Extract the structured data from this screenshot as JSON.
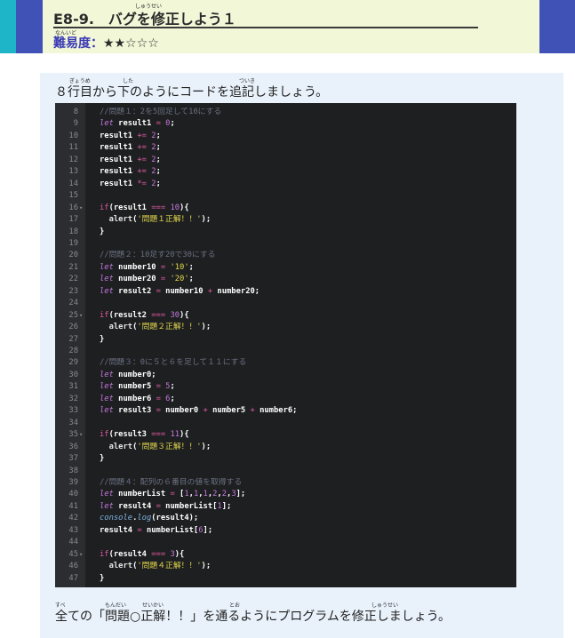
{
  "header": {
    "title": "E8-9.　バグを修正しよう１",
    "ruby_title": "しゅうせい",
    "difficulty_label": "難易度：",
    "ruby_difficulty": "なんいど",
    "difficulty_stars": "★★☆☆☆"
  },
  "intro": {
    "text": "８行目から下のようにコードを追記しましょう。",
    "ruby_1": "ぎょうめ",
    "ruby_2": "した",
    "ruby_3": "ついき"
  },
  "outro": {
    "text": "全ての「問題○正解！！」を通るようにプログラムを修正しましょう。",
    "ruby_1": "すべ",
    "ruby_2": "もんだい",
    "ruby_3": "せいかい",
    "ruby_4": "とお",
    "ruby_5": "しゅうせい"
  },
  "code": {
    "lines": [
      {
        "n": "8",
        "fold": "",
        "parts": [
          [
            "c-com",
            "//問題１：2を5回足して10にする"
          ]
        ]
      },
      {
        "n": "9",
        "fold": "",
        "parts": [
          [
            "c-kw",
            "let"
          ],
          [
            "c-plain",
            " result1 "
          ],
          [
            "c-op",
            "="
          ],
          [
            "c-plain",
            " "
          ],
          [
            "c-num",
            "0"
          ],
          [
            "c-plain",
            ";"
          ]
        ]
      },
      {
        "n": "10",
        "fold": "",
        "parts": [
          [
            "c-plain",
            "result1 "
          ],
          [
            "c-op",
            "+="
          ],
          [
            "c-plain",
            " "
          ],
          [
            "c-num",
            "2"
          ],
          [
            "c-plain",
            ";"
          ]
        ]
      },
      {
        "n": "11",
        "fold": "",
        "parts": [
          [
            "c-plain",
            "result1 "
          ],
          [
            "c-op",
            "+="
          ],
          [
            "c-plain",
            " "
          ],
          [
            "c-num",
            "2"
          ],
          [
            "c-plain",
            ";"
          ]
        ]
      },
      {
        "n": "12",
        "fold": "",
        "parts": [
          [
            "c-plain",
            "result1 "
          ],
          [
            "c-op",
            "+="
          ],
          [
            "c-plain",
            " "
          ],
          [
            "c-num",
            "2"
          ],
          [
            "c-plain",
            ";"
          ]
        ]
      },
      {
        "n": "13",
        "fold": "",
        "parts": [
          [
            "c-plain",
            "result1 "
          ],
          [
            "c-op",
            "+="
          ],
          [
            "c-plain",
            " "
          ],
          [
            "c-num",
            "2"
          ],
          [
            "c-plain",
            ";"
          ]
        ]
      },
      {
        "n": "14",
        "fold": "",
        "parts": [
          [
            "c-plain",
            "result1 "
          ],
          [
            "c-op",
            "*="
          ],
          [
            "c-plain",
            " "
          ],
          [
            "c-num",
            "2"
          ],
          [
            "c-plain",
            ";"
          ]
        ]
      },
      {
        "n": "15",
        "fold": "",
        "parts": []
      },
      {
        "n": "16",
        "fold": "▾",
        "parts": [
          [
            "c-if",
            "if"
          ],
          [
            "c-plain",
            "(result1 "
          ],
          [
            "c-op",
            "==="
          ],
          [
            "c-plain",
            " "
          ],
          [
            "c-num",
            "10"
          ],
          [
            "c-plain",
            "){"
          ]
        ]
      },
      {
        "n": "17",
        "fold": "",
        "parts": [
          [
            "c-fn",
            "  alert"
          ],
          [
            "c-plain",
            "("
          ],
          [
            "c-str",
            "'問題１正解！！'"
          ],
          [
            "c-plain",
            ");"
          ]
        ]
      },
      {
        "n": "18",
        "fold": "",
        "parts": [
          [
            "c-plain",
            "}"
          ]
        ]
      },
      {
        "n": "19",
        "fold": "",
        "parts": []
      },
      {
        "n": "20",
        "fold": "",
        "parts": [
          [
            "c-com",
            "//問題２：10足す20で30にする"
          ]
        ]
      },
      {
        "n": "21",
        "fold": "",
        "parts": [
          [
            "c-kw",
            "let"
          ],
          [
            "c-plain",
            " number10 "
          ],
          [
            "c-op",
            "="
          ],
          [
            "c-plain",
            " "
          ],
          [
            "c-str",
            "'10'"
          ],
          [
            "c-plain",
            ";"
          ]
        ]
      },
      {
        "n": "22",
        "fold": "",
        "parts": [
          [
            "c-kw",
            "let"
          ],
          [
            "c-plain",
            " number20 "
          ],
          [
            "c-op",
            "="
          ],
          [
            "c-plain",
            " "
          ],
          [
            "c-str",
            "'20'"
          ],
          [
            "c-plain",
            ";"
          ]
        ]
      },
      {
        "n": "23",
        "fold": "",
        "parts": [
          [
            "c-kw",
            "let"
          ],
          [
            "c-plain",
            " result2 "
          ],
          [
            "c-op",
            "="
          ],
          [
            "c-plain",
            " number10 "
          ],
          [
            "c-op",
            "+"
          ],
          [
            "c-plain",
            " number20;"
          ]
        ]
      },
      {
        "n": "24",
        "fold": "",
        "parts": []
      },
      {
        "n": "25",
        "fold": "▾",
        "parts": [
          [
            "c-if",
            "if"
          ],
          [
            "c-plain",
            "(result2 "
          ],
          [
            "c-op",
            "==="
          ],
          [
            "c-plain",
            " "
          ],
          [
            "c-num",
            "30"
          ],
          [
            "c-plain",
            "){"
          ]
        ]
      },
      {
        "n": "26",
        "fold": "",
        "parts": [
          [
            "c-fn",
            "  alert"
          ],
          [
            "c-plain",
            "("
          ],
          [
            "c-str",
            "'問題２正解！！'"
          ],
          [
            "c-plain",
            ");"
          ]
        ]
      },
      {
        "n": "27",
        "fold": "",
        "parts": [
          [
            "c-plain",
            "}"
          ]
        ]
      },
      {
        "n": "28",
        "fold": "",
        "parts": []
      },
      {
        "n": "29",
        "fold": "",
        "parts": [
          [
            "c-com",
            "//問題３：0に５と６を足して１１にする"
          ]
        ]
      },
      {
        "n": "30",
        "fold": "",
        "parts": [
          [
            "c-kw",
            "let"
          ],
          [
            "c-plain",
            " number0;"
          ]
        ]
      },
      {
        "n": "31",
        "fold": "",
        "parts": [
          [
            "c-kw",
            "let"
          ],
          [
            "c-plain",
            " number5 "
          ],
          [
            "c-op",
            "="
          ],
          [
            "c-plain",
            " "
          ],
          [
            "c-num",
            "5"
          ],
          [
            "c-plain",
            ";"
          ]
        ]
      },
      {
        "n": "32",
        "fold": "",
        "parts": [
          [
            "c-kw",
            "let"
          ],
          [
            "c-plain",
            " number6 "
          ],
          [
            "c-op",
            "="
          ],
          [
            "c-plain",
            " "
          ],
          [
            "c-num",
            "6"
          ],
          [
            "c-plain",
            ";"
          ]
        ]
      },
      {
        "n": "33",
        "fold": "",
        "parts": [
          [
            "c-kw",
            "let"
          ],
          [
            "c-plain",
            " result3 "
          ],
          [
            "c-op",
            "="
          ],
          [
            "c-plain",
            " number0 "
          ],
          [
            "c-op",
            "+"
          ],
          [
            "c-plain",
            " number5 "
          ],
          [
            "c-op",
            "+"
          ],
          [
            "c-plain",
            " number6;"
          ]
        ]
      },
      {
        "n": "34",
        "fold": "",
        "parts": []
      },
      {
        "n": "35",
        "fold": "▾",
        "parts": [
          [
            "c-if",
            "if"
          ],
          [
            "c-plain",
            "(result3 "
          ],
          [
            "c-op",
            "==="
          ],
          [
            "c-plain",
            " "
          ],
          [
            "c-num",
            "11"
          ],
          [
            "c-plain",
            "){"
          ]
        ]
      },
      {
        "n": "36",
        "fold": "",
        "parts": [
          [
            "c-fn",
            "  alert"
          ],
          [
            "c-plain",
            "("
          ],
          [
            "c-str",
            "'問題３正解！！'"
          ],
          [
            "c-plain",
            ");"
          ]
        ]
      },
      {
        "n": "37",
        "fold": "",
        "parts": [
          [
            "c-plain",
            "}"
          ]
        ]
      },
      {
        "n": "38",
        "fold": "",
        "parts": []
      },
      {
        "n": "39",
        "fold": "",
        "parts": [
          [
            "c-com",
            "//問題４：配列の６番目の値を取得する"
          ]
        ]
      },
      {
        "n": "40",
        "fold": "",
        "parts": [
          [
            "c-kw",
            "let"
          ],
          [
            "c-plain",
            " numberList "
          ],
          [
            "c-op",
            "="
          ],
          [
            "c-plain",
            " ["
          ],
          [
            "c-num",
            "1"
          ],
          [
            "c-plain",
            ","
          ],
          [
            "c-num",
            "1"
          ],
          [
            "c-plain",
            ","
          ],
          [
            "c-num",
            "1"
          ],
          [
            "c-plain",
            ","
          ],
          [
            "c-num",
            "2"
          ],
          [
            "c-plain",
            ","
          ],
          [
            "c-num",
            "2"
          ],
          [
            "c-plain",
            ","
          ],
          [
            "c-num",
            "3"
          ],
          [
            "c-plain",
            "];"
          ]
        ]
      },
      {
        "n": "41",
        "fold": "",
        "parts": [
          [
            "c-kw",
            "let"
          ],
          [
            "c-plain",
            " result4 "
          ],
          [
            "c-op",
            "="
          ],
          [
            "c-plain",
            " numberList["
          ],
          [
            "c-num",
            "1"
          ],
          [
            "c-plain",
            "];"
          ]
        ]
      },
      {
        "n": "42",
        "fold": "",
        "parts": [
          [
            "c-con",
            "console"
          ],
          [
            "c-plain",
            "."
          ],
          [
            "c-con",
            "log"
          ],
          [
            "c-plain",
            "(result4);"
          ]
        ]
      },
      {
        "n": "43",
        "fold": "",
        "parts": [
          [
            "c-plain",
            "result4 "
          ],
          [
            "c-op",
            "="
          ],
          [
            "c-plain",
            " numberList["
          ],
          [
            "c-num",
            "6"
          ],
          [
            "c-plain",
            "];"
          ]
        ]
      },
      {
        "n": "44",
        "fold": "",
        "parts": []
      },
      {
        "n": "45",
        "fold": "▾",
        "parts": [
          [
            "c-if",
            "if"
          ],
          [
            "c-plain",
            "(result4 "
          ],
          [
            "c-op",
            "==="
          ],
          [
            "c-plain",
            " "
          ],
          [
            "c-num",
            "3"
          ],
          [
            "c-plain",
            "){"
          ]
        ]
      },
      {
        "n": "46",
        "fold": "",
        "parts": [
          [
            "c-fn",
            "  alert"
          ],
          [
            "c-plain",
            "("
          ],
          [
            "c-str",
            "'問題４正解！！'"
          ],
          [
            "c-plain",
            ");"
          ]
        ]
      },
      {
        "n": "47",
        "fold": "",
        "parts": [
          [
            "c-plain",
            "}"
          ]
        ]
      }
    ]
  }
}
